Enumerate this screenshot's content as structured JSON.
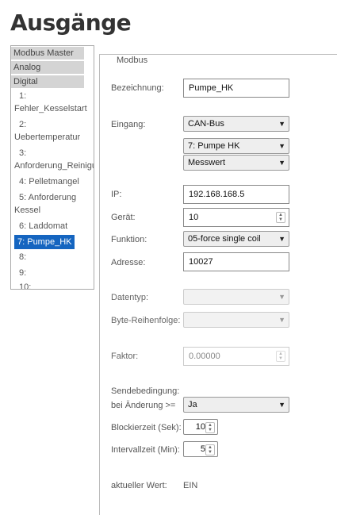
{
  "page": {
    "title": "Ausgänge"
  },
  "sidebar": {
    "groups": [
      "Modbus Master",
      "Analog",
      "Digital"
    ],
    "items": [
      {
        "num": "1:",
        "name": "Fehler_Kesselstart"
      },
      {
        "num": "2:",
        "name": "Uebertemperatur"
      },
      {
        "num": "3:",
        "name": "Anforderung_Reinigung"
      },
      {
        "label": "4: Pelletmangel"
      },
      {
        "label": "5: Anforderung Kessel"
      },
      {
        "label": "6: Laddomat"
      },
      {
        "label": "7: Pumpe_HK"
      },
      {
        "label": "8:"
      },
      {
        "label": "9:"
      },
      {
        "label": "10:"
      }
    ]
  },
  "form": {
    "legend": "Modbus",
    "bezeichnung": {
      "label": "Bezeichnung:",
      "value": "Pumpe_HK"
    },
    "eingang": {
      "label": "Eingang:",
      "select1": "CAN-Bus",
      "select2": "7: Pumpe HK",
      "select3": "Messwert"
    },
    "ip": {
      "label": "IP:",
      "value": "192.168.168.5"
    },
    "geraet": {
      "label": "Gerät:",
      "value": "10"
    },
    "funktion": {
      "label": "Funktion:",
      "value": "05-force single coil"
    },
    "adresse": {
      "label": "Adresse:",
      "value": "10027"
    },
    "datentyp": {
      "label": "Datentyp:",
      "value": ""
    },
    "byte_reihenfolge": {
      "label": "Byte-Reihenfolge:",
      "value": ""
    },
    "faktor": {
      "label": "Faktor:",
      "value": "0.00000"
    },
    "sendebedingung": {
      "label1": "Sendebedingung:",
      "label2": "bei Änderung >=",
      "value": "Ja"
    },
    "blockierzeit": {
      "label": "Blockierzeit (Sek):",
      "value": "10"
    },
    "intervallzeit": {
      "label": "Intervallzeit (Min):",
      "value": "5"
    },
    "aktueller_wert": {
      "label": "aktueller Wert:",
      "value": "EIN"
    }
  }
}
